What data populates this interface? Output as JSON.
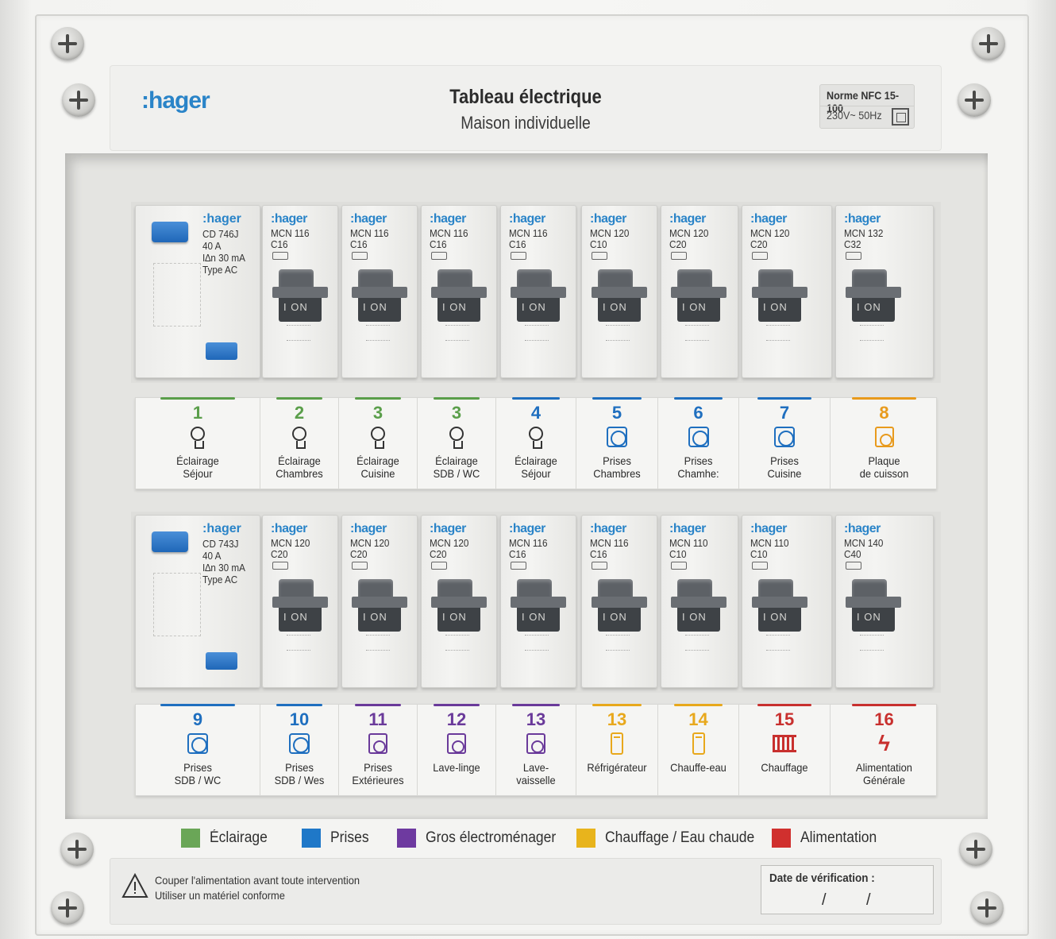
{
  "header": {
    "brand": ":hager",
    "title": "Tableau électrique",
    "subtitle": "Maison individuelle",
    "norm": "Norme NFC 15-100",
    "voltage": "230V~ 50Hz"
  },
  "row1": {
    "rcd": {
      "brand": ":hager",
      "line1": "CD 746J",
      "line2": "40 A",
      "line3": "I∆n 30 mA",
      "line4": "Type AC"
    },
    "breakers": [
      {
        "brand": ":hager",
        "model": "MCN 116",
        "rating": "C16",
        "handle": "I ON"
      },
      {
        "brand": ":hager",
        "model": "MCN 116",
        "rating": "C16",
        "handle": "I ON"
      },
      {
        "brand": ":hager",
        "model": "MCN 116",
        "rating": "C16",
        "handle": "I ON"
      },
      {
        "brand": ":hager",
        "model": "MCN 116",
        "rating": "C16",
        "handle": "I ON"
      },
      {
        "brand": ":hager",
        "model": "MCN 120",
        "rating": "C10",
        "handle": "I ON"
      },
      {
        "brand": ":hager",
        "model": "MCN 120",
        "rating": "C20",
        "handle": "I ON"
      },
      {
        "brand": ":hager",
        "model": "MCN 120",
        "rating": "C20",
        "handle": "I ON"
      },
      {
        "brand": ":hager",
        "model": "MCN 132",
        "rating": "C32",
        "handle": "I ON"
      }
    ],
    "labels": [
      {
        "num": "1",
        "line1": "Éclairage",
        "line2": "Séjour",
        "icon": "bulb",
        "color": "#5a9e4a"
      },
      {
        "num": "2",
        "line1": "Éclairage",
        "line2": "Chambres",
        "icon": "bulb",
        "color": "#5a9e4a"
      },
      {
        "num": "3",
        "line1": "Éclairage",
        "line2": "Cuisine",
        "icon": "bulb",
        "color": "#5a9e4a"
      },
      {
        "num": "3",
        "line1": "Éclairage",
        "line2": "SDB / WC",
        "icon": "bulb",
        "color": "#5a9e4a"
      },
      {
        "num": "4",
        "line1": "Éclairage",
        "line2": "Séjour",
        "icon": "bulb",
        "color": "#1f6fbf"
      },
      {
        "num": "5",
        "line1": "Prises",
        "line2": "Chambres",
        "icon": "socket",
        "color": "#1f6fbf"
      },
      {
        "num": "6",
        "line1": "Prises",
        "line2": "Chamhe:",
        "icon": "socket",
        "color": "#1f6fbf"
      },
      {
        "num": "7",
        "line1": "Prises",
        "line2": "Cuisine",
        "icon": "socket",
        "color": "#1f6fbf"
      },
      {
        "num": "8",
        "line1": "Plaque",
        "line2": "de cuisson",
        "icon": "cooktop",
        "color": "#e89a1c"
      }
    ]
  },
  "row2": {
    "rcd": {
      "brand": ":hager",
      "line1": "CD 743J",
      "line2": "40 A",
      "line3": "I∆n 30 mA",
      "line4": "Type AC"
    },
    "breakers": [
      {
        "brand": ":hager",
        "model": "MCN 120",
        "rating": "C20",
        "handle": "I ON"
      },
      {
        "brand": ":hager",
        "model": "MCN 120",
        "rating": "C20",
        "handle": "I ON"
      },
      {
        "brand": ":hager",
        "model": "MCN 120",
        "rating": "C20",
        "handle": "I ON"
      },
      {
        "brand": ":hager",
        "model": "MCN 116",
        "rating": "C16",
        "handle": "I ON"
      },
      {
        "brand": ":hager",
        "model": "MCN 116",
        "rating": "C16",
        "handle": "I ON"
      },
      {
        "brand": ":hager",
        "model": "MCN 110",
        "rating": "C10",
        "handle": "I ON"
      },
      {
        "brand": ":hager",
        "model": "MCN 110",
        "rating": "C10",
        "handle": "I ON"
      },
      {
        "brand": ":hager",
        "model": "MCN 140",
        "rating": "C40",
        "handle": "I ON"
      }
    ],
    "labels": [
      {
        "num": "9",
        "line1": "Prises",
        "line2": "SDB / WC",
        "icon": "socket",
        "color": "#1f6fbf"
      },
      {
        "num": "10",
        "line1": "Prises",
        "line2": "SDB / Wes",
        "icon": "socket",
        "color": "#1f6fbf"
      },
      {
        "num": "11",
        "line1": "Prises",
        "line2": "Extérieures",
        "icon": "box",
        "color": "#6a3a9a"
      },
      {
        "num": "12",
        "line1": "Lave-linge",
        "line2": "",
        "icon": "washer",
        "color": "#6a3a9a"
      },
      {
        "num": "13",
        "line1": "Lave-",
        "line2": "vaisselle",
        "icon": "dishwasher",
        "color": "#6a3a9a"
      },
      {
        "num": "13",
        "line1": "Réfrigérateur",
        "line2": "",
        "icon": "fridge",
        "color": "#e8a81c"
      },
      {
        "num": "14",
        "line1": "Chauffe-eau",
        "line2": "",
        "icon": "boiler",
        "color": "#e8a81c"
      },
      {
        "num": "15",
        "line1": "Chauffage",
        "line2": "",
        "icon": "radiator",
        "color": "#c8302e"
      },
      {
        "num": "16",
        "line1": "Alimentation",
        "line2": "Générale",
        "icon": "bolt",
        "color": "#c8302e"
      }
    ]
  },
  "legend": [
    {
      "label": "Éclairage",
      "color": "#6aa657"
    },
    {
      "label": "Prises",
      "color": "#1f78c8"
    },
    {
      "label": "Gros électroménager",
      "color": "#6e3aa0"
    },
    {
      "label": "Chauffage / Eau chaude",
      "color": "#e8b41c"
    },
    {
      "label": "Alimentation",
      "color": "#d0302e"
    }
  ],
  "footer": {
    "warning_line1": "Couper l'alimentation avant toute intervention",
    "warning_line2": "Utiliser un matériel conforme",
    "date_label": "Date de vérification :",
    "date_sep1": "/",
    "date_sep2": "/"
  }
}
